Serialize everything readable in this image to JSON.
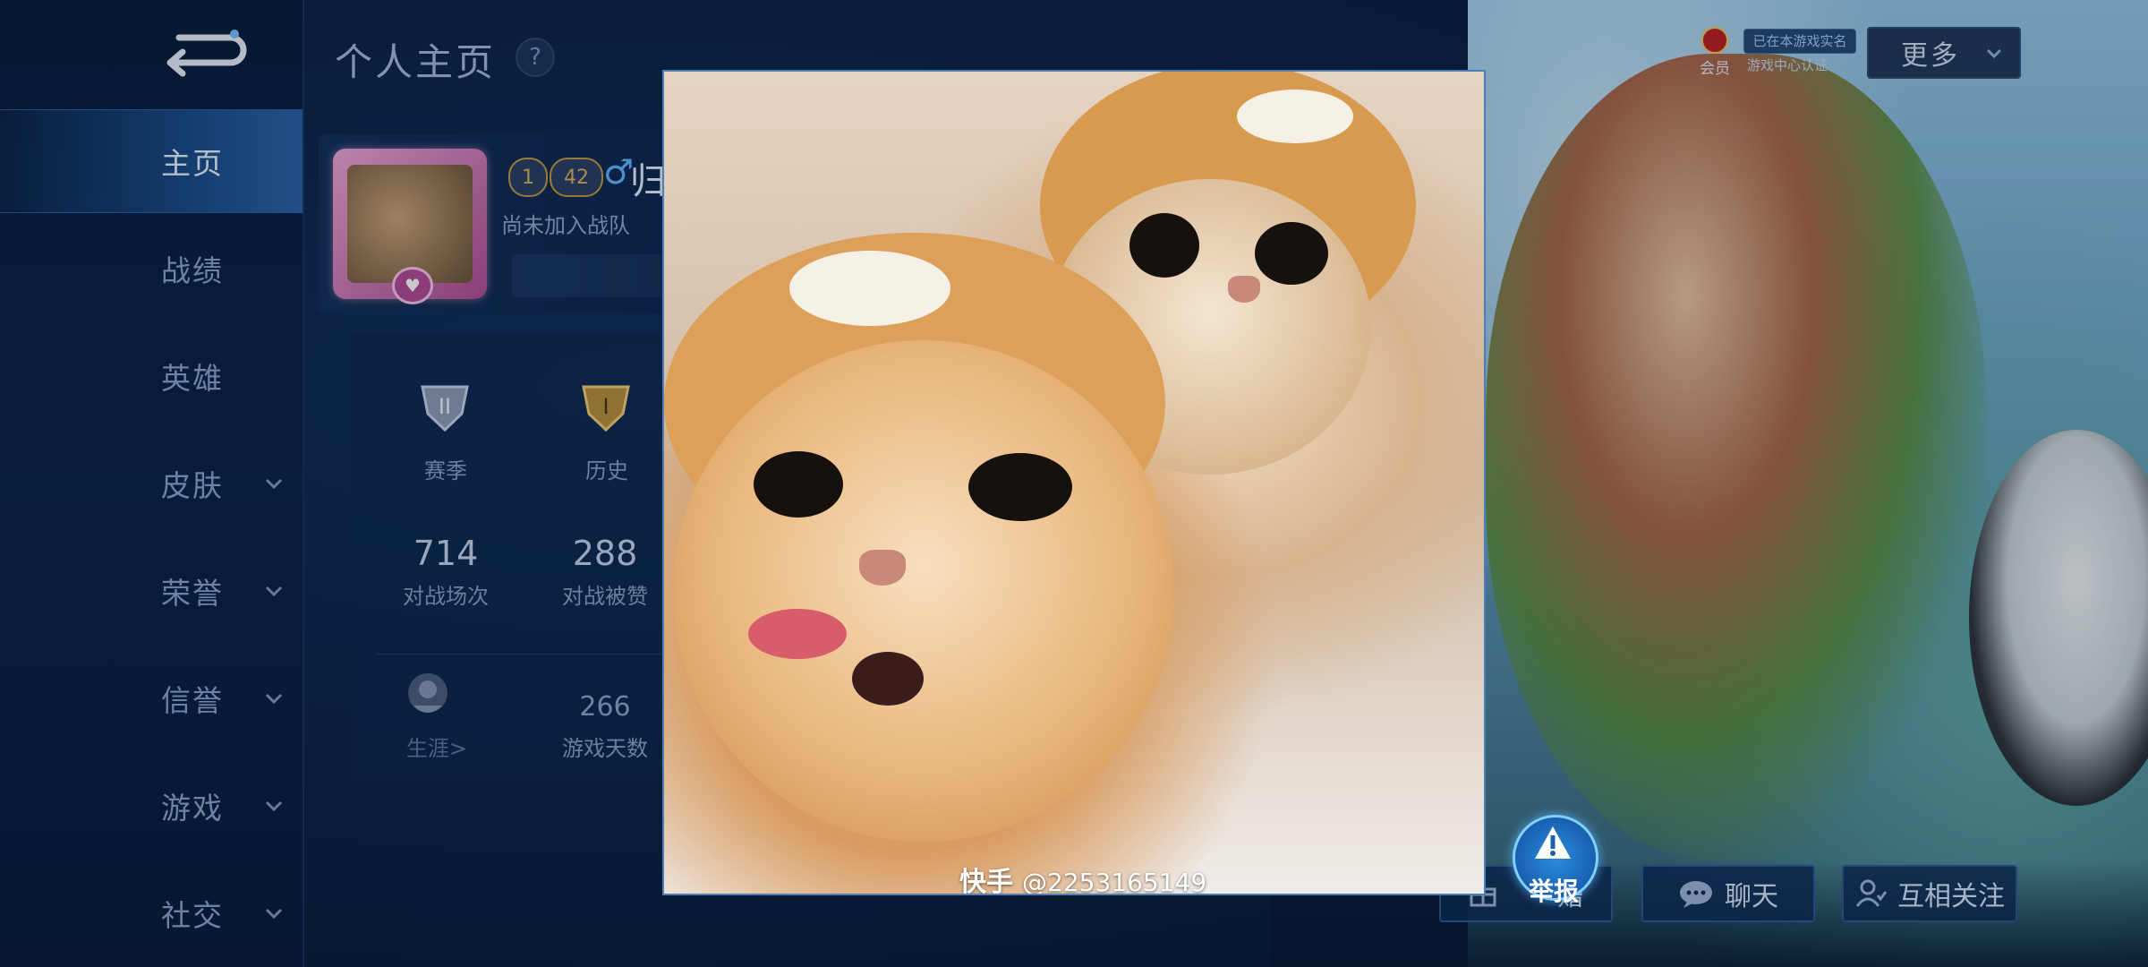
{
  "header": {
    "title": "个人主页",
    "help": "?"
  },
  "sidebar": {
    "items": [
      {
        "label": "主页",
        "active": true
      },
      {
        "label": "战绩"
      },
      {
        "label": "英雄"
      },
      {
        "label": "皮肤"
      },
      {
        "label": "荣誉"
      },
      {
        "label": "信誉"
      },
      {
        "label": "游戏"
      },
      {
        "label": "社交"
      }
    ]
  },
  "profile": {
    "rank1": "1",
    "level": "42",
    "gender": "♂",
    "name_partial": "归",
    "team": "尚未加入战队"
  },
  "stats": {
    "season_label": "赛季",
    "history_label": "历史",
    "battles_value": "714",
    "battles_label": "对战场次",
    "likes_value": "288",
    "likes_label": "对战被赞",
    "career_label": "生涯>",
    "days_value": "266",
    "days_label": "游戏天数"
  },
  "topright": {
    "member_label": "会员",
    "realname_badge": "已在本游戏实名",
    "verify_text": "游戏中心认证",
    "more_label": "更多"
  },
  "bottom_actions": {
    "gift_partial": "赠",
    "chat": "聊天",
    "follow": "互相关注",
    "report": "举报"
  },
  "photo": {
    "watermark_brand": "快手",
    "watermark_id": "@2253165149"
  },
  "colors": {
    "sidebar_active": "#2a64a6",
    "accent_blue": "#2a8de0",
    "text_muted": "#8aa6cf"
  }
}
